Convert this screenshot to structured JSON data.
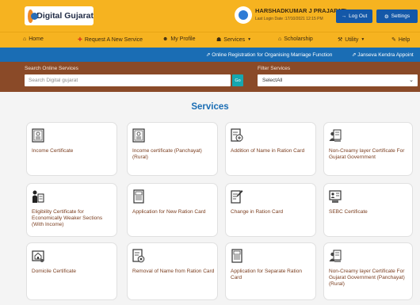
{
  "header": {
    "logo_text": "Digital Gujarat",
    "user_name": "HARSHADKUMAR J PRAJAPATI",
    "last_login": "Last Login Date :17/10/2021 12:15 PM",
    "logout_label": "Log Out",
    "settings_label": "Settings"
  },
  "nav": {
    "home": "Home",
    "request_service": "Request A New Service",
    "my_profile": "My Profile",
    "services": "Services",
    "scholarship": "Scholarship",
    "utility": "Utility",
    "help": "Help"
  },
  "strip": {
    "link1": "Online Registration for Organising Marriage Function",
    "link2": "Janseva Kendra Appoint"
  },
  "search": {
    "label": "Search Online Services",
    "placeholder": "Search Digital gujarat",
    "go_label": "Go"
  },
  "filter": {
    "label": "Filter Services",
    "selected": "SelectAll"
  },
  "services": {
    "title": "Services",
    "cards": [
      {
        "label": "Income Certificate",
        "icon": "certificate-icon"
      },
      {
        "label": "Income certificate (Panchayat) (Rural)",
        "icon": "certificate-icon"
      },
      {
        "label": "Addition of Name in Ration Card",
        "icon": "add-document-icon"
      },
      {
        "label": "Non-Creamy layer Certificate For Gujarat Government",
        "icon": "people-document-icon"
      },
      {
        "label": "Eligibility Certificate for Economically Weaker Sections (With Income)",
        "icon": "person-document-icon"
      },
      {
        "label": "Application for New Ration Card",
        "icon": "book-icon"
      },
      {
        "label": "Change in Ration Card",
        "icon": "edit-document-icon"
      },
      {
        "label": "SEBC Certificate",
        "icon": "id-card-icon"
      },
      {
        "label": "Domicile Certificate",
        "icon": "house-certificate-icon"
      },
      {
        "label": "Removal of Name from Ration Card",
        "icon": "remove-document-icon"
      },
      {
        "label": "Application for Separate Ration Card",
        "icon": "book-icon"
      },
      {
        "label": "Non-Creamy layer Certificate For Gujarat Government (Panchayat) (Rural)",
        "icon": "people-document-icon"
      }
    ]
  },
  "colors": {
    "header": "#f6b320",
    "strip": "#1a6db4",
    "band": "#8a4a28",
    "accent": "#1458a8",
    "card_text": "#7a3d1e"
  }
}
